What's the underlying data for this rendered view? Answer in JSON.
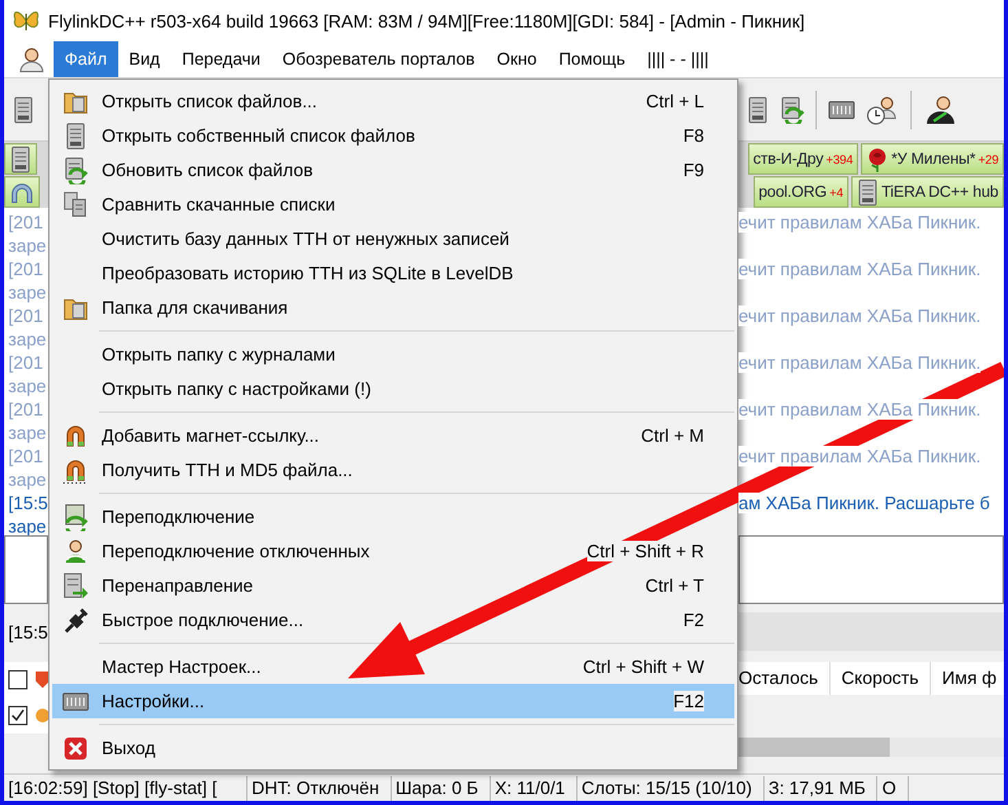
{
  "window": {
    "title": "FlylinkDC++ r503-x64 build 19663 [RAM: 83M / 94M][Free:1180M][GDI: 584] - [Admin - Пикник]"
  },
  "menubar": {
    "items": [
      {
        "label": "Файл",
        "selected": true
      },
      {
        "label": "Вид",
        "selected": false
      },
      {
        "label": "Передачи",
        "selected": false
      },
      {
        "label": "Обозреватель порталов",
        "selected": false
      },
      {
        "label": "Окно",
        "selected": false
      },
      {
        "label": "Помощь",
        "selected": false
      },
      {
        "label": "||||  -  -  ||||",
        "selected": false
      }
    ]
  },
  "menu": {
    "groups": [
      {
        "items": [
          {
            "label": "Открыть список файлов...",
            "shortcut": "Ctrl + L",
            "selected": false
          },
          {
            "label": "Открыть собственный список файлов",
            "shortcut": "F8",
            "selected": false
          },
          {
            "label": "Обновить список файлов",
            "shortcut": "F9",
            "selected": false
          },
          {
            "label": "Сравнить скачанные списки",
            "selected": false
          },
          {
            "label": "Очистить базу данных TTH от ненужных записей",
            "selected": false
          },
          {
            "label": "Преобразовать историю TTH из SQLite в LevelDB",
            "selected": false
          },
          {
            "label": "Папка для скачивания",
            "selected": false
          }
        ]
      },
      {
        "items": [
          {
            "label": "Открыть папку с журналами",
            "selected": false
          },
          {
            "label": "Открыть папку с настройками (!)",
            "selected": false
          }
        ]
      },
      {
        "items": [
          {
            "label": "Добавить магнет-ссылку...",
            "shortcut": "Ctrl + M",
            "selected": false
          },
          {
            "label": "Получить TTH и MD5 файла...",
            "selected": false
          }
        ]
      },
      {
        "items": [
          {
            "label": "Переподключение",
            "selected": false
          },
          {
            "label": "Переподключение отключенных",
            "shortcut": "Ctrl + Shift + R",
            "selected": false
          },
          {
            "label": "Перенаправление",
            "shortcut": "Ctrl + T",
            "selected": false
          },
          {
            "label": "Быстрое подключение...",
            "shortcut": "F2",
            "selected": false
          }
        ]
      },
      {
        "items": [
          {
            "label": "Мастер Настроек...",
            "shortcut": "Ctrl + Shift + W",
            "selected": false
          },
          {
            "label": "Настройки...",
            "shortcut": "F12",
            "selected": true
          }
        ]
      },
      {
        "items": [
          {
            "label": "Выход",
            "selected": false
          }
        ]
      }
    ]
  },
  "hub_tabs": [
    [
      {
        "label": "ств-И-Дру",
        "badge": "+394"
      },
      {
        "label": "*У Милены*",
        "badge": "+29"
      }
    ],
    [
      {
        "label": "pool.ORG",
        "badge": "+4"
      },
      {
        "label": "TiERA DC++ hub"
      }
    ]
  ],
  "chat": [
    {
      "left": "[201",
      "right": "ечит правилам ХАБа Пикник.",
      "kind": "system"
    },
    {
      "left": "заре",
      "kind": "system"
    },
    {
      "left": "[201",
      "right": "ечит правилам ХАБа Пикник.",
      "kind": "system"
    },
    {
      "left": "заре",
      "kind": "system"
    },
    {
      "left": "[201",
      "right": "ечит правилам ХАБа Пикник.",
      "kind": "system"
    },
    {
      "left": "заре",
      "kind": "system"
    },
    {
      "left": "[201",
      "right": "ечит правилам ХАБа Пикник.",
      "kind": "system"
    },
    {
      "left": "заре",
      "kind": "system"
    },
    {
      "left": "[201",
      "right": "ечит правилам ХАБа Пикник.",
      "kind": "system"
    },
    {
      "left": "заре",
      "kind": "system"
    },
    {
      "left": "[201",
      "right": "ечит правилам ХАБа Пикник.",
      "kind": "system"
    },
    {
      "left": "заре",
      "kind": "system"
    },
    {
      "left": "[15:5",
      "right": "ам ХАБа Пикник. Расшарьте б",
      "kind": "own"
    },
    {
      "left": "заре",
      "kind": "own"
    }
  ],
  "log_line": "[15:5",
  "favorites": [
    {
      "checked": false
    },
    {
      "checked": true
    }
  ],
  "table": {
    "columns": [
      "Осталось",
      "Скорость",
      "Имя ф"
    ]
  },
  "status_bar": [
    "[16:02:59] [Stop] [fly-stat] [",
    "DHT: Отключён",
    "Шара: 0 Б",
    "X: 11/0/1",
    "Слоты: 15/15 (10/10)",
    "З: 17,91 МБ",
    "О"
  ]
}
